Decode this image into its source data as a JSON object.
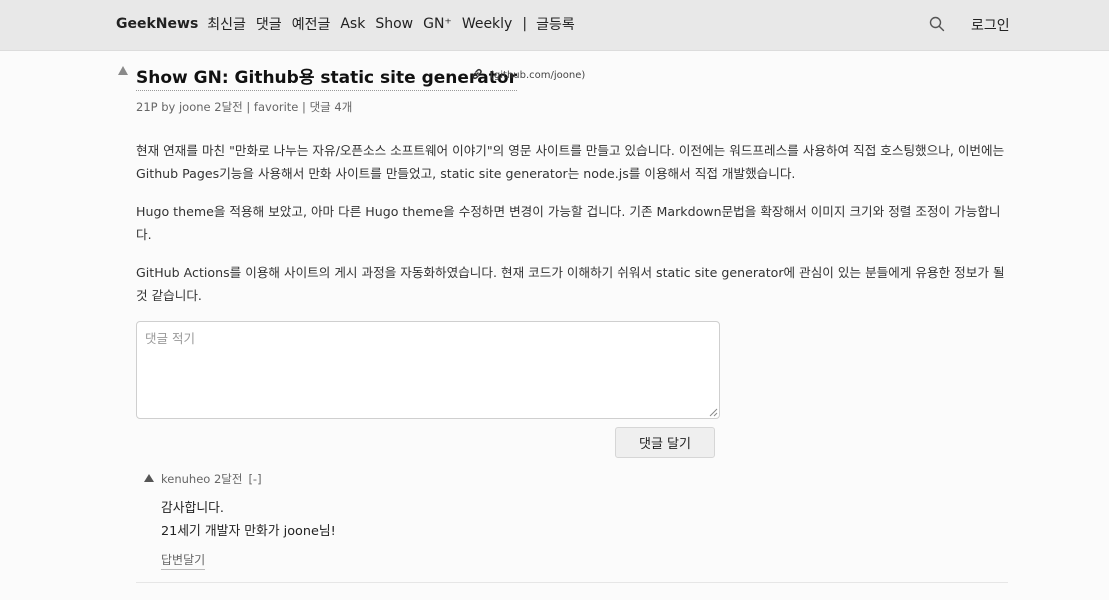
{
  "nav": {
    "brand": "GeekNews",
    "items": [
      "최신글",
      "댓글",
      "예전글",
      "Ask",
      "Show",
      "GN⁺",
      "Weekly"
    ],
    "separator": "|",
    "submit": "글등록",
    "login": "로그인"
  },
  "post": {
    "title": "Show GN: Github용 static site generator",
    "domain": "(github.com/joone)",
    "meta": "21P by joone 2달전 | favorite | 댓글 4개",
    "paragraphs": [
      "현재 연재를 마친 \"만화로 나누는 자유/오픈소스 소프트웨어 이야기\"의 영문 사이트를 만들고 있습니다. 이전에는 워드프레스를 사용하여 직접 호스팅했으나, 이번에는 Github Pages기능을 사용해서 만화 사이트를 만들었고, static site generator는 node.js를 이용해서 직접 개발했습니다.",
      "Hugo theme을 적용해 보았고, 아마 다른 Hugo theme을 수정하면 변경이 가능할 겁니다. 기존 Markdown문법을 확장해서 이미지 크기와 정렬 조정이 가능합니다.",
      "GitHub Actions를 이용해 사이트의 게시 과정을 자동화하였습니다. 현재 코드가 이해하기 쉬워서 static site generator에 관심이 있는 분들에게 유용한 정보가 될 것 같습니다."
    ]
  },
  "comment_form": {
    "placeholder": "댓글 적기",
    "submit_label": "댓글 달기"
  },
  "comments": [
    {
      "meta": "kenuheo 2달전",
      "collapse": "[-]",
      "lines": [
        "감사합니다.",
        "21세기 개발자 만화가 joone님!"
      ],
      "reply_label": "답변달기"
    }
  ],
  "colors": {
    "topbar": "#e8e8e8",
    "background": "#fbfbfb",
    "text": "#333333",
    "muted": "#666666"
  },
  "icons": {
    "search": "search-icon",
    "link": "link-icon",
    "upvote": "upvote-arrow-icon"
  }
}
